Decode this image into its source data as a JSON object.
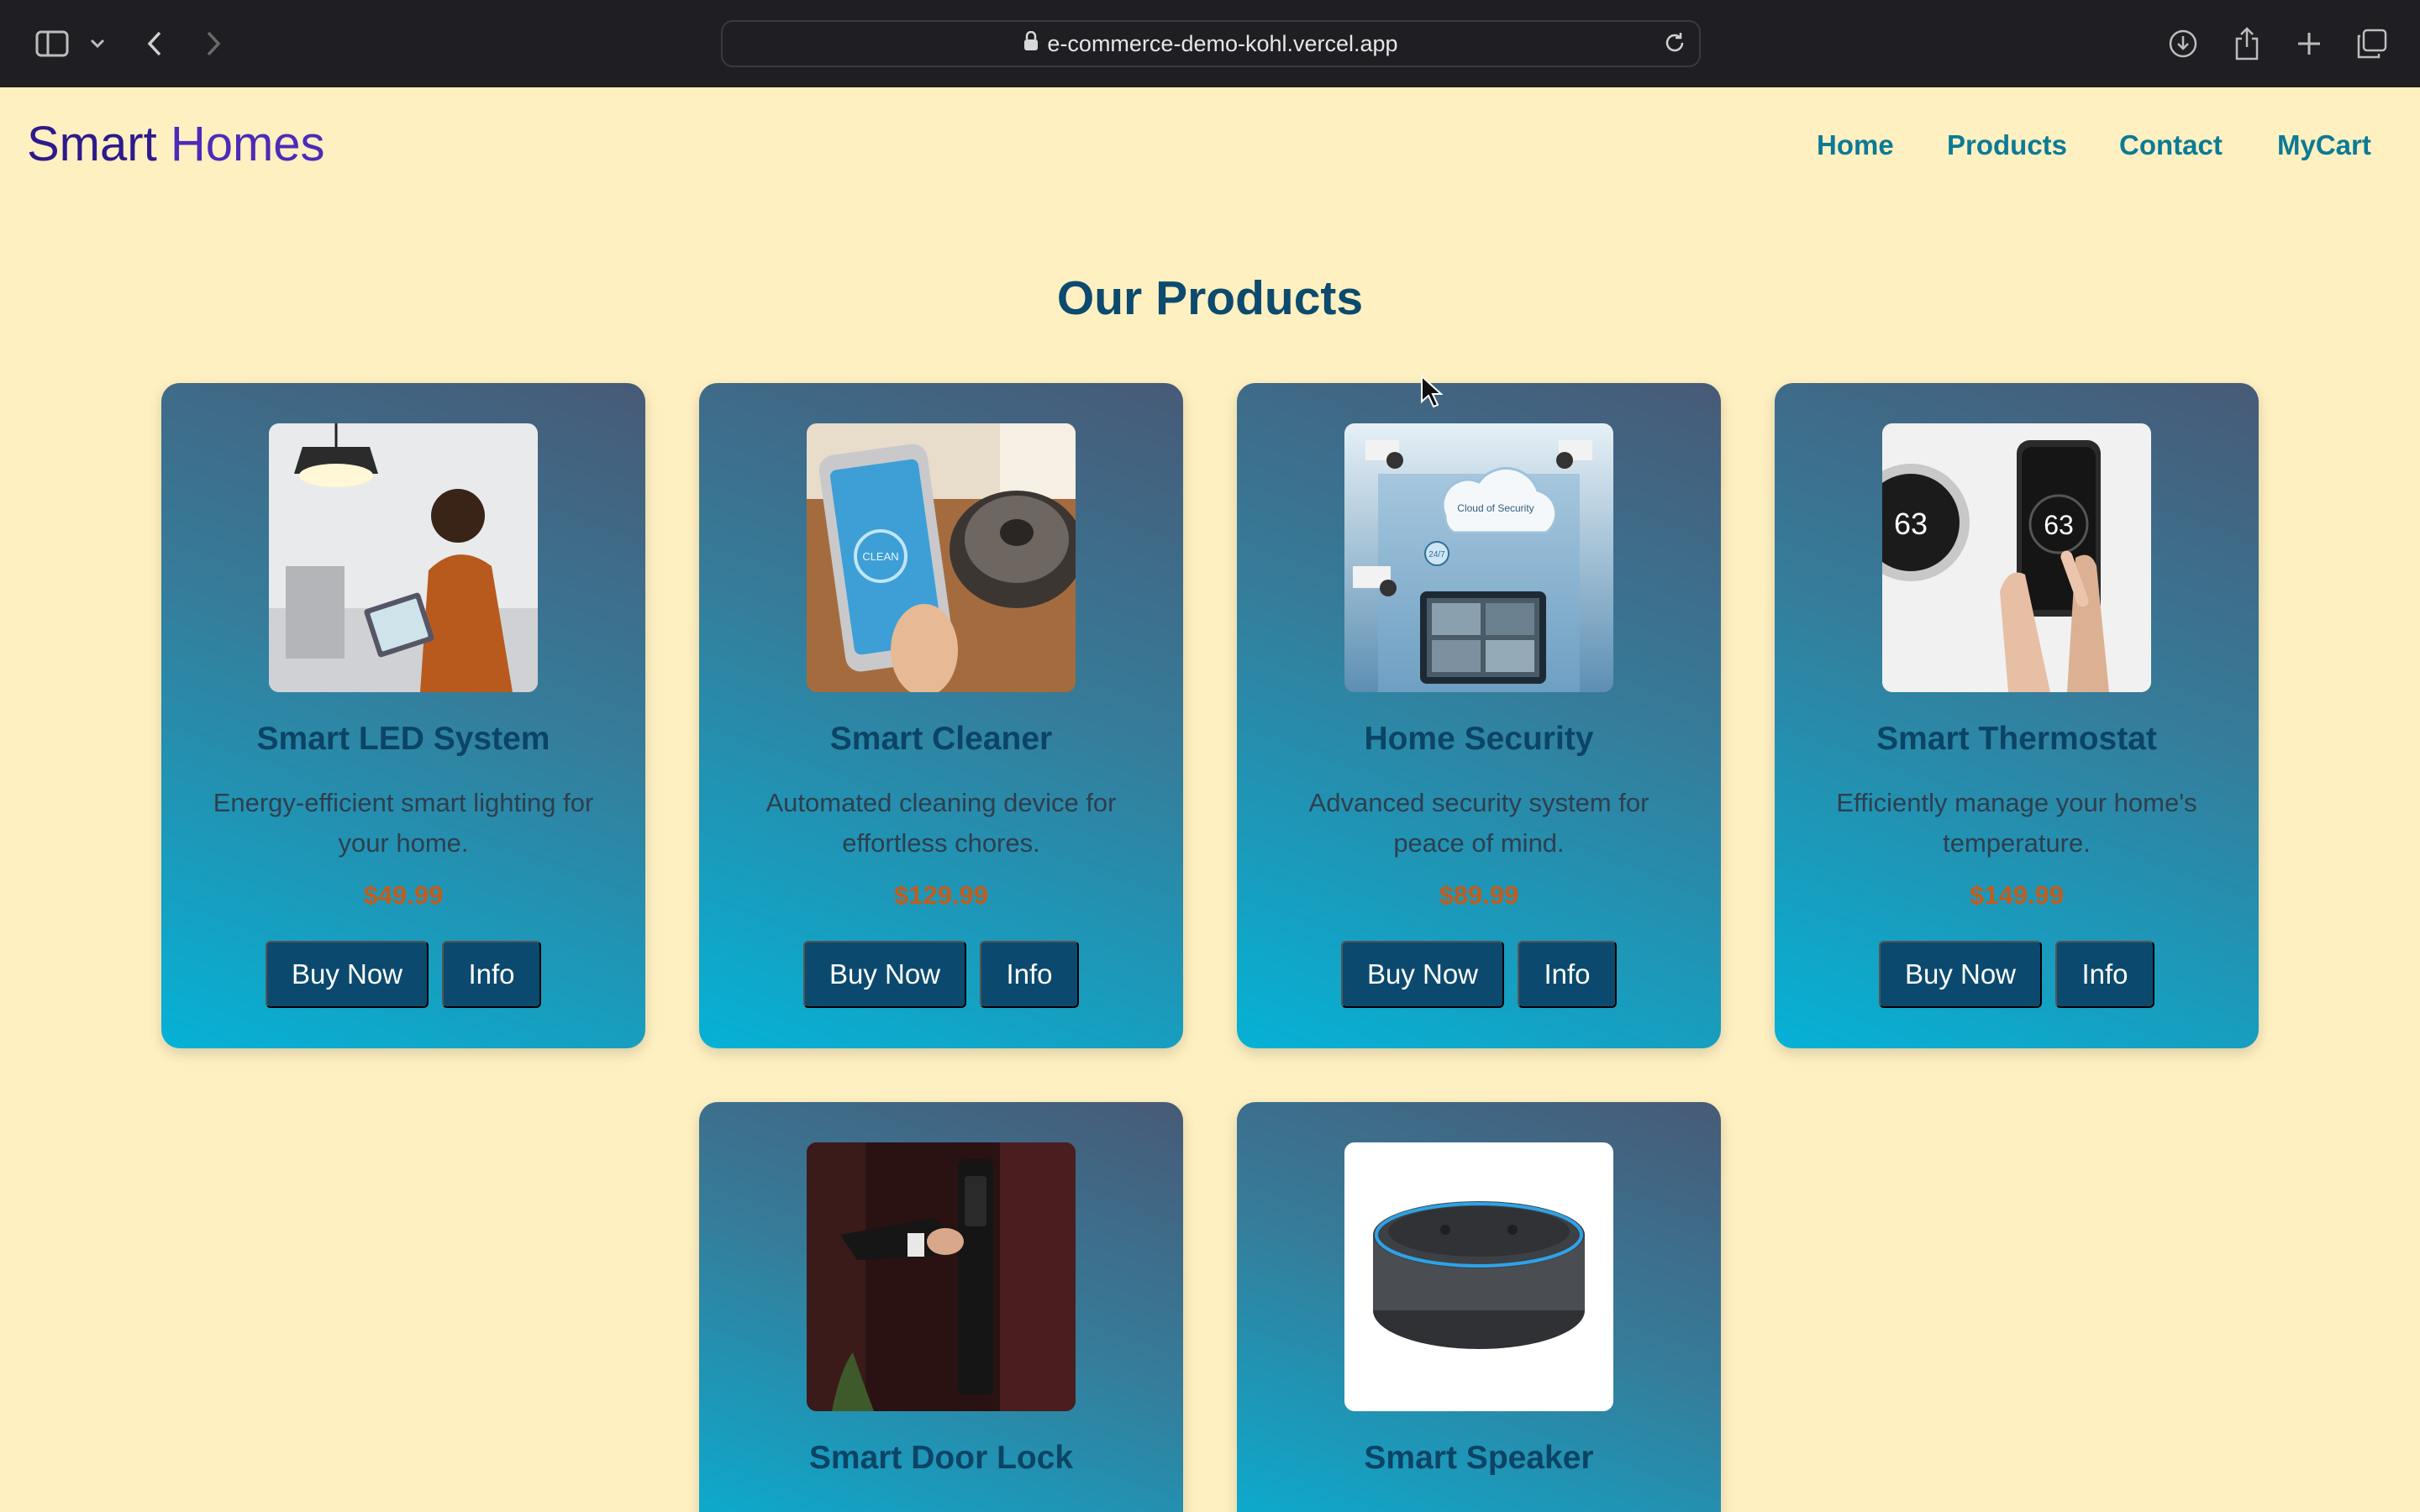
{
  "browser": {
    "url": "e-commerce-demo-kohl.vercel.app",
    "icons": [
      "sidebar-icon",
      "chevron-down-icon",
      "back-icon",
      "forward-icon",
      "lock-icon",
      "reload-icon",
      "download-icon",
      "share-icon",
      "plus-icon",
      "tabs-icon"
    ]
  },
  "site": {
    "brand_part1": "Smart ",
    "brand_part2": "Homes",
    "nav": [
      "Home",
      "Products",
      "Contact",
      "MyCart"
    ]
  },
  "page_title": "Our Products",
  "products": [
    {
      "name": "Smart LED System",
      "description": "Energy-efficient smart lighting for your home.",
      "price": "$49.99",
      "buy_label": "Buy Now",
      "info_label": "Info"
    },
    {
      "name": "Smart Cleaner",
      "description": "Automated cleaning device for effortless chores.",
      "price": "$129.99",
      "buy_label": "Buy Now",
      "info_label": "Info"
    },
    {
      "name": "Home Security",
      "description": "Advanced security system for peace of mind.",
      "price": "$89.99",
      "buy_label": "Buy Now",
      "info_label": "Info"
    },
    {
      "name": "Smart Thermostat",
      "description": "Efficiently manage your home's temperature.",
      "price": "$149.99",
      "buy_label": "Buy Now",
      "info_label": "Info"
    },
    {
      "name": "Smart Door Lock"
    },
    {
      "name": "Smart Speaker"
    }
  ],
  "image_text": {
    "cleaner_screen": "CLEAN",
    "security_cloud": "Cloud of Security",
    "security_badge": "24/7",
    "thermostat_wall": "63",
    "thermostat_phone": "63"
  },
  "colors": {
    "page_background": "#fef0c1",
    "brand": "#2d1a8c",
    "nav_link": "#0c7a96",
    "title": "#0c4a6e",
    "price": "#c35c1a",
    "button": "#0b4a6e"
  }
}
